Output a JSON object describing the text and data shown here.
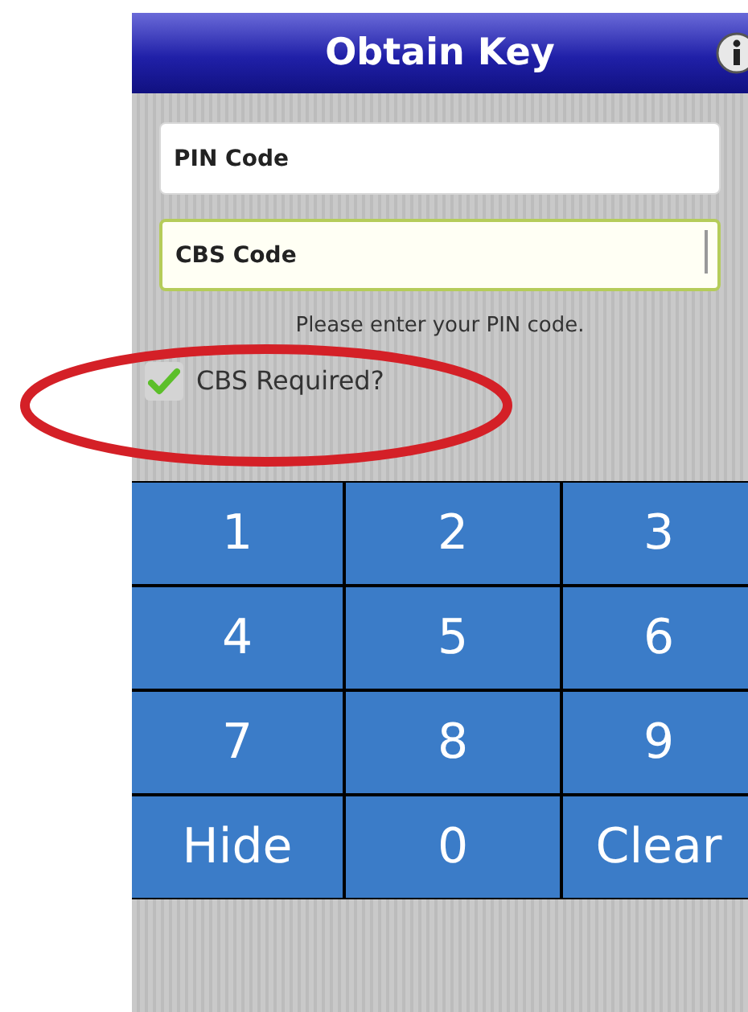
{
  "header": {
    "title": "Obtain Key"
  },
  "fields": [
    {
      "placeholder": "PIN Code",
      "focused": false
    },
    {
      "placeholder": "CBS Code",
      "focused": true
    }
  ],
  "message": "Please enter your PIN code.",
  "checkbox": {
    "label": "CBS Required?",
    "checked": true
  },
  "keypad": {
    "keys": [
      "1",
      "2",
      "3",
      "4",
      "5",
      "6",
      "7",
      "8",
      "9",
      "Hide",
      "0",
      "Clear"
    ]
  }
}
